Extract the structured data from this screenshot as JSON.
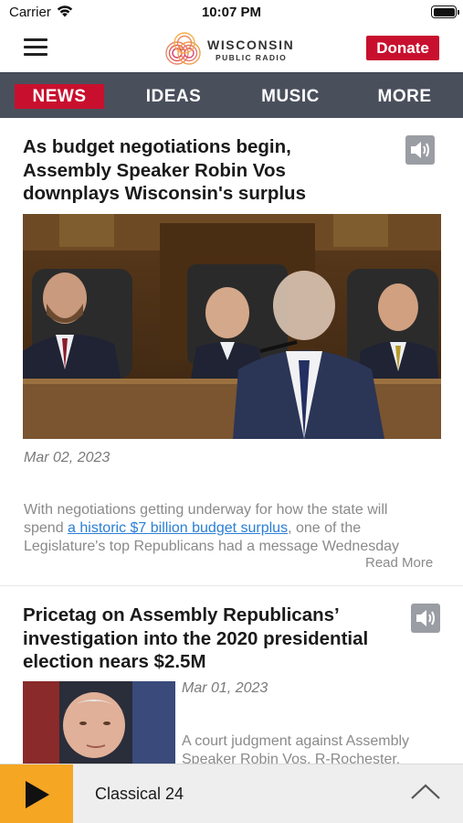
{
  "status_bar": {
    "carrier": "Carrier",
    "time": "10:07 PM"
  },
  "header": {
    "logo_line_1": "WISCONSIN",
    "logo_line_2": "PUBLIC RADIO",
    "donate_label": "Donate"
  },
  "nav": {
    "tabs": [
      {
        "label": "News",
        "active": true
      },
      {
        "label": "Ideas",
        "active": false
      },
      {
        "label": "Music",
        "active": false
      },
      {
        "label": "More",
        "active": false
      }
    ]
  },
  "articles": [
    {
      "headline_lines": [
        "As budget negotiations begin,",
        "Assembly Speaker Robin Vos",
        "downplays Wisconsin's surplus"
      ],
      "date": "Mar 02, 2023",
      "summary_line_1": "With negotiations getting underway for how the state will",
      "summary_prefix": "spend ",
      "summary_link": "a historic $7 billion budget surplus",
      "summary_suffix": ", one of the",
      "summary_line_3": "Legislature's top Republicans had a message Wednesday",
      "read_more": "Read More"
    },
    {
      "headline_lines": [
        "Pricetag on Assembly Republicans’",
        "investigation into the 2020 presidential",
        "election nears $2.5M"
      ],
      "date": "Mar 01, 2023",
      "summary_line_1": "A court judgment against Assembly",
      "summary_line_2": "Speaker Robin Vos, R-Rochester,"
    }
  ],
  "player": {
    "station": "Classical 24"
  },
  "colors": {
    "brand_red": "#c8102e",
    "nav_bg": "#4a4f5c",
    "player_accent": "#f5a623",
    "link_blue": "#2a7fd6"
  }
}
